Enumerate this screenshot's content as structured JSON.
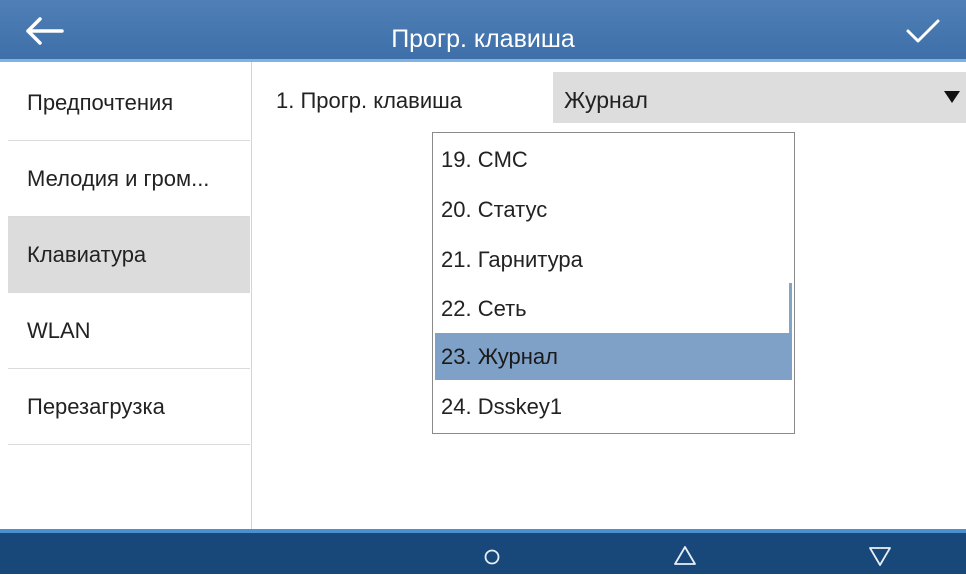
{
  "header": {
    "title": "Прогр. клавиша",
    "back_icon": "arrow-left-icon",
    "confirm_icon": "checkmark-icon"
  },
  "sidebar": {
    "items": [
      {
        "label": "Предпочтения",
        "active": false
      },
      {
        "label": "Мелодия и гром...",
        "active": false
      },
      {
        "label": "Клавиатура",
        "active": true
      },
      {
        "label": "WLAN",
        "active": false
      },
      {
        "label": "Перезагрузка",
        "active": false
      }
    ]
  },
  "main": {
    "field_label": "1. Прогр. клавиша",
    "select_value": "Журнал",
    "dropdown": {
      "options": [
        {
          "label": "19. CMC",
          "selected": false
        },
        {
          "label": "20. Статус",
          "selected": false
        },
        {
          "label": "21. Гарнитура",
          "selected": false
        },
        {
          "label": "22. Сеть",
          "selected": false
        },
        {
          "label": "23. Журнал",
          "selected": true
        },
        {
          "label": "24. Dsskey1",
          "selected": false
        }
      ]
    }
  },
  "footer": {
    "buttons": [
      "circle-icon",
      "triangle-up-icon",
      "triangle-down-icon"
    ]
  },
  "colors": {
    "header_bg": "#4a7ab2",
    "footer_bg": "#18487a",
    "selected_row": "#7fa1c7",
    "active_sidebar": "#dcdcdc"
  }
}
